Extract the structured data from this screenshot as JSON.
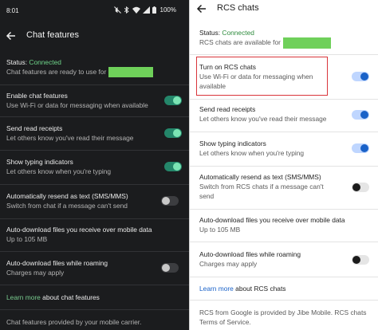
{
  "left": {
    "status_bar": {
      "time": "8:01",
      "battery": "100%"
    },
    "title": "Chat features",
    "status": {
      "label": "Status: ",
      "value": "Connected",
      "subtitle": "Chat features are ready to use for"
    },
    "settings": [
      {
        "title": "Enable chat features",
        "subtitle": "Use Wi-Fi or data for messaging when available",
        "toggle": "on"
      },
      {
        "title": "Send read receipts",
        "subtitle": "Let others know you've read their message",
        "toggle": "on"
      },
      {
        "title": "Show typing indicators",
        "subtitle": "Let others know when you're typing",
        "toggle": "on"
      },
      {
        "title": "Automatically resend as text (SMS/MMS)",
        "subtitle": "Switch from chat if a message can't send",
        "toggle": "off"
      },
      {
        "title": "Auto-download files you receive over mobile data",
        "subtitle": "Up to 105 MB"
      },
      {
        "title": "Auto-download files while roaming",
        "subtitle": "Charges may apply",
        "toggle": "off"
      }
    ],
    "learn_more": {
      "link": "Learn more",
      "rest": " about chat features"
    },
    "footer": "Chat features provided by your mobile carrier."
  },
  "right": {
    "title": "RCS chats",
    "status": {
      "label": "Status: ",
      "value": "Connected",
      "subtitle": "RCS chats are available for"
    },
    "settings": [
      {
        "title": "Turn on RCS chats",
        "subtitle": "Use Wi-Fi or data for messaging when",
        "subtitle2": "available",
        "toggle": "on"
      },
      {
        "title": "Send read receipts",
        "subtitle": "Let others know you've read their message",
        "toggle": "on"
      },
      {
        "title": "Show typing indicators",
        "subtitle": "Let others know when you're typing",
        "toggle": "on"
      },
      {
        "title": "Automatically resend as text (SMS/MMS)",
        "subtitle": "Switch from RCS chats if a message can't",
        "subtitle2": "send",
        "toggle": "off"
      },
      {
        "title": "Auto-download files you receive over mobile data",
        "subtitle": "Up to 105 MB"
      },
      {
        "title": "Auto-download files while roaming",
        "subtitle": "Charges may apply",
        "toggle": "off"
      }
    ],
    "learn_more": {
      "link": "Learn more",
      "rest": " about RCS chats"
    },
    "footer": "RCS from Google is provided by Jibe Mobile. RCS chats",
    "footer2": "Terms of Service."
  },
  "colors": {
    "dark_bg": "#1b1c1e",
    "dark_accent": "#6fd58a",
    "light_accent": "#1a62c8",
    "highlight_border": "#d9353b",
    "redaction": "#6fd05a"
  }
}
